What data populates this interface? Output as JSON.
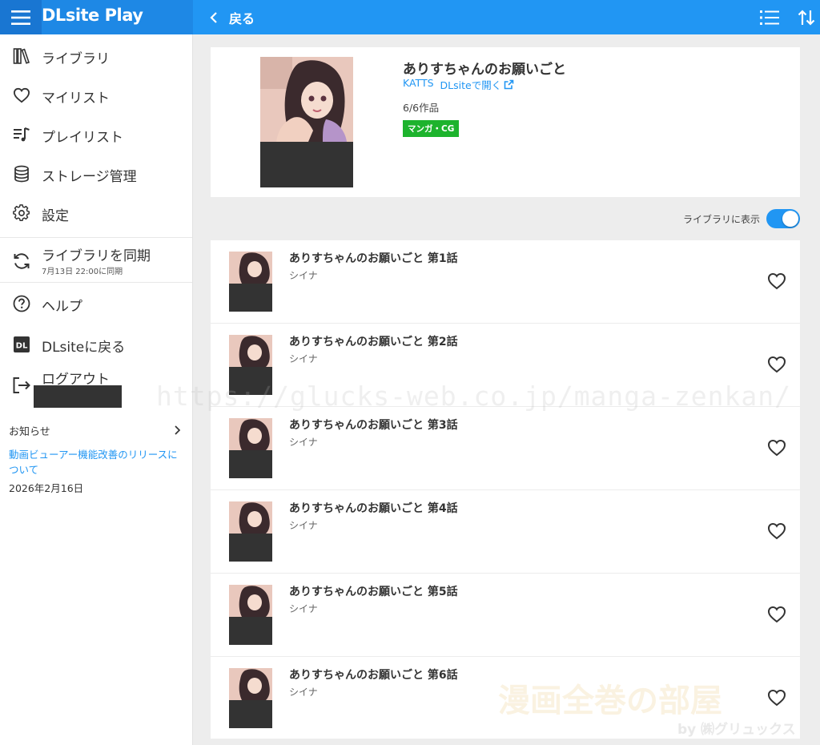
{
  "header": {
    "brand": "DLsite Play",
    "back_label": "戻る"
  },
  "sidebar": {
    "items": [
      {
        "label": "ライブラリ",
        "icon": "library-icon"
      },
      {
        "label": "マイリスト",
        "icon": "heart-icon"
      },
      {
        "label": "プレイリスト",
        "icon": "playlist-icon"
      },
      {
        "label": "ストレージ管理",
        "icon": "storage-icon"
      },
      {
        "label": "設定",
        "icon": "gear-icon"
      }
    ],
    "sync": {
      "label": "ライブラリを同期",
      "sub": "7月13日 22:00に同期"
    },
    "help_label": "ヘルプ",
    "dlsite_label": "DLsiteに戻る",
    "logout_label": "ログアウト",
    "notice": {
      "title": "お知らせ",
      "link": "動画ビューアー機能改善のリリースについて",
      "date": "2026年2月16日"
    }
  },
  "work": {
    "title": "ありすちゃんのお願いごと",
    "circle": "KATTS",
    "open_link": "DLsiteで開く",
    "count": "6/6作品",
    "genre": "マンガ・CG"
  },
  "library_toggle": {
    "label": "ライブラリに表示",
    "on": true
  },
  "episodes": [
    {
      "title": "ありすちゃんのお願いごと 第1話",
      "author": "シイナ"
    },
    {
      "title": "ありすちゃんのお願いごと 第2話",
      "author": "シイナ"
    },
    {
      "title": "ありすちゃんのお願いごと 第3話",
      "author": "シイナ"
    },
    {
      "title": "ありすちゃんのお願いごと 第4話",
      "author": "シイナ"
    },
    {
      "title": "ありすちゃんのお願いごと 第5話",
      "author": "シイナ"
    },
    {
      "title": "ありすちゃんのお願いごと 第6話",
      "author": "シイナ"
    }
  ],
  "watermarks": {
    "url": "https://glucks-web.co.jp/manga-zenkan/",
    "logo": "漫画全巻の部屋",
    "by": "by ㈱グリュックス"
  },
  "colors": {
    "accent": "#2196f3",
    "badge_green": "#1db32d",
    "redaction": "#333333"
  }
}
